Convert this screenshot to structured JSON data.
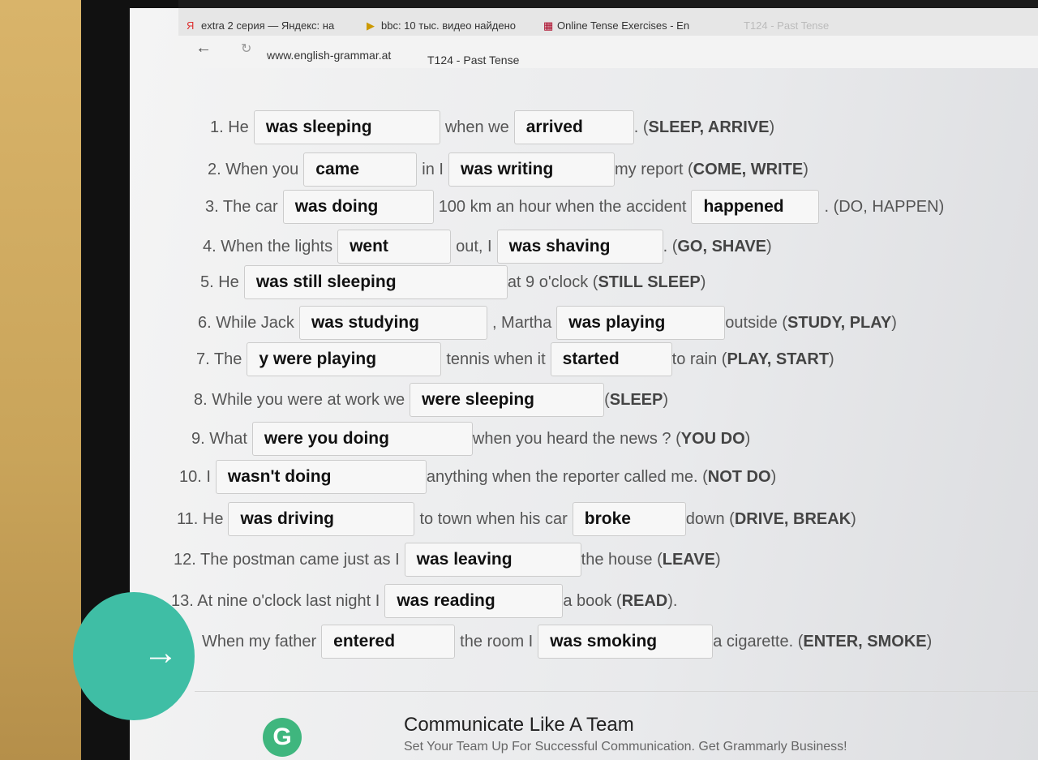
{
  "browser": {
    "tabs": [
      {
        "label": "extra 2 серия — Яндекс: на"
      },
      {
        "label": "bbc: 10 тыс. видео найдено"
      },
      {
        "label": "Online Tense Exercises - En"
      },
      {
        "label": "T124 - Past Tense"
      }
    ],
    "url": "www.english-grammar.at",
    "page_title": "T124 - Past Tense"
  },
  "exercise": [
    [
      {
        "t": "1. He"
      },
      {
        "v": "was sleeping"
      },
      {
        "t": "when we"
      },
      {
        "v": "arrived"
      },
      {
        "t": ". ("
      },
      {
        "b": "SLEEP, ARRIVE"
      },
      {
        "t": ")"
      }
    ],
    [
      {
        "t": "2. When you"
      },
      {
        "v": "came"
      },
      {
        "t": "in I"
      },
      {
        "v": "was writing"
      },
      {
        "t": "my report ("
      },
      {
        "b": "COME, WRITE"
      },
      {
        "t": ")"
      }
    ],
    [
      {
        "t": "3. The car"
      },
      {
        "v": "was doing"
      },
      {
        "t": "100 km an hour when the accident"
      },
      {
        "v": "happened"
      },
      {
        "t": ". (DO, HAPPEN)"
      }
    ],
    [
      {
        "t": "4. When the lights"
      },
      {
        "v": "went"
      },
      {
        "t": "out, I"
      },
      {
        "v": "was  shaving"
      },
      {
        "t": ". ("
      },
      {
        "b": "GO, SHAVE"
      },
      {
        "t": ")"
      }
    ],
    [
      {
        "t": "5. He"
      },
      {
        "v": "was still sleeping"
      },
      {
        "t": "at 9 o'clock ("
      },
      {
        "b": "STILL SLEEP"
      },
      {
        "t": ")"
      }
    ],
    [
      {
        "t": "6. While Jack"
      },
      {
        "v": "was studying"
      },
      {
        "t": ", Martha"
      },
      {
        "v": "was playing"
      },
      {
        "t": "outside ("
      },
      {
        "b": "STUDY, PLAY"
      },
      {
        "t": ")"
      }
    ],
    [
      {
        "t": "7. The"
      },
      {
        "v": "y were playing"
      },
      {
        "t": "tennis when it"
      },
      {
        "v": "started"
      },
      {
        "t": "to rain ("
      },
      {
        "b": "PLAY, START"
      },
      {
        "t": ")"
      }
    ],
    [
      {
        "t": "8. While you were at work we"
      },
      {
        "v": "were sleeping"
      },
      {
        "t": "("
      },
      {
        "b": "SLEEP"
      },
      {
        "t": ")"
      }
    ],
    [
      {
        "t": "9. What"
      },
      {
        "v": "were you doing"
      },
      {
        "t": "when you heard the news ? ("
      },
      {
        "b": "YOU DO"
      },
      {
        "t": ")"
      }
    ],
    [
      {
        "t": "10. I"
      },
      {
        "v": "wasn't doing"
      },
      {
        "t": "anything when the reporter called me. ("
      },
      {
        "b": "NOT DO"
      },
      {
        "t": ")"
      }
    ],
    [
      {
        "t": "11. He"
      },
      {
        "v": "was driving"
      },
      {
        "t": "to town when his car"
      },
      {
        "v": "broke"
      },
      {
        "t": "down ("
      },
      {
        "b": "DRIVE, BREAK"
      },
      {
        "t": ")"
      }
    ],
    [
      {
        "t": "12. The postman came just as I"
      },
      {
        "v": "was leaving"
      },
      {
        "t": "the house ("
      },
      {
        "b": "LEAVE"
      },
      {
        "t": ")"
      }
    ],
    [
      {
        "t": "13. At nine o'clock last night I"
      },
      {
        "v": "was reading"
      },
      {
        "t": "a book ("
      },
      {
        "b": "READ"
      },
      {
        "t": ")."
      }
    ],
    [
      {
        "t": "When my father"
      },
      {
        "v": "entered"
      },
      {
        "t": "the room I"
      },
      {
        "v": "was smoking"
      },
      {
        "t": "a cigarette. ("
      },
      {
        "b": "ENTER, SMOKE"
      },
      {
        "t": ")"
      }
    ]
  ],
  "next_button": {
    "icon": "arrow-right-icon",
    "color": "#3fbea5"
  },
  "ad": {
    "title": "Communicate Like A Team",
    "subtitle": "Set Your Team Up For Successful Communication. Get Grammarly Business!",
    "logo_letter": "G"
  }
}
